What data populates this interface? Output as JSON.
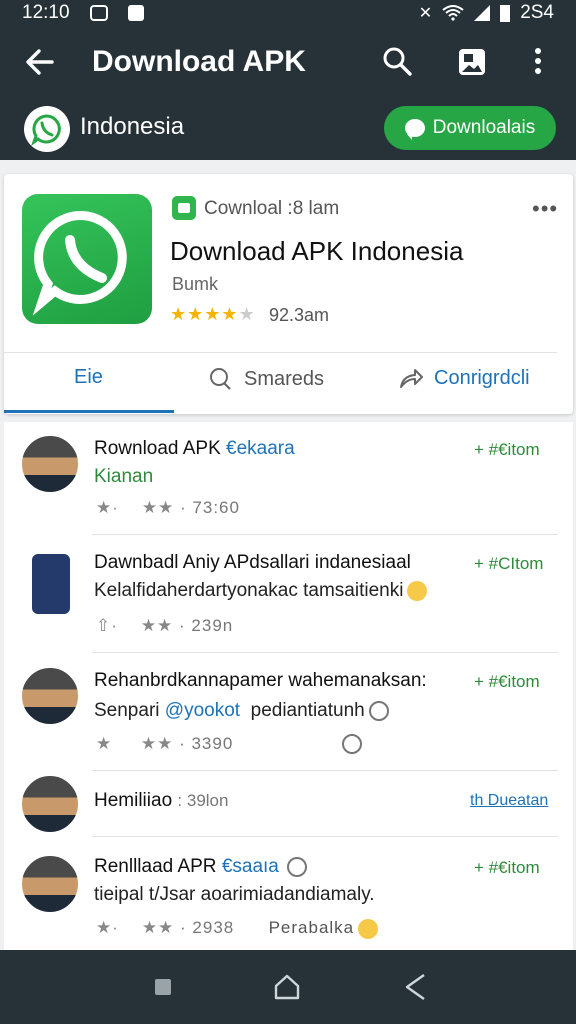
{
  "status_bar": {
    "time": "12:10",
    "battery_text": "2S4"
  },
  "app_bar": {
    "title": "Download APK",
    "region": "Indonesia",
    "download_button": "Downloalais"
  },
  "app_card": {
    "developer": "Cownloal :8 lam",
    "title": "Download APK Indonesia",
    "subtitle": "Bumk",
    "rating": 3.5,
    "rating_text": "92.3am",
    "more": "•••",
    "tabs": [
      {
        "label": "Eie",
        "icon": "",
        "active": true
      },
      {
        "label": "Smareds",
        "icon": "search-icon",
        "active": false
      },
      {
        "label": "Conrigrdcli",
        "icon": "share-icon",
        "active": false
      }
    ]
  },
  "list": {
    "rows": [
      {
        "title": "Rownload APK",
        "handle": "€ekaara",
        "line2": "Kianan",
        "line2_style": "green",
        "meta_stars_a": "★·",
        "meta_stars_b": "★★",
        "meta_count": "· 73:60",
        "action": "+ #€itom"
      },
      {
        "title": "Dawnbadl Aniy APdsallari indanesiaal",
        "handle": "",
        "line2": "Kelalfidaherdartyonakac tamsaitienki",
        "line2_style": "normal",
        "meta_stars_a": "⇧·",
        "meta_stars_b": "★★",
        "meta_count": "· 239n",
        "action": "+ #CItom"
      },
      {
        "title": "Rehanbrdkannapamer wahemanaksan:",
        "handle": "",
        "line2_prefix": "Senpari",
        "line2_handle": "@yookot",
        "line2_suffix": "pediantiatunh",
        "line2_style": "normal",
        "meta_stars_a": "★",
        "meta_stars_b": "★★",
        "meta_count": "· 3390",
        "action": "+ #€itom"
      },
      {
        "title": "Hemiliiao",
        "meta_inline": ": 39lon",
        "link": "th Dueatan"
      },
      {
        "title": "Renlllaad APR",
        "handle": "€saaıa",
        "line2": "tieipal t/Jsar aoarimiadandiamaly.",
        "line2_style": "green-mixed",
        "meta_stars_a": "★·",
        "meta_stars_b": "★★",
        "meta_count": "· 2938",
        "meta_extra": "Perabalka",
        "action": "+ #€itom"
      }
    ]
  },
  "colors": {
    "app_bar": "#263238",
    "accent_green": "#27a645",
    "link_blue": "#1d72b8",
    "star_yellow": "#f4b400"
  }
}
